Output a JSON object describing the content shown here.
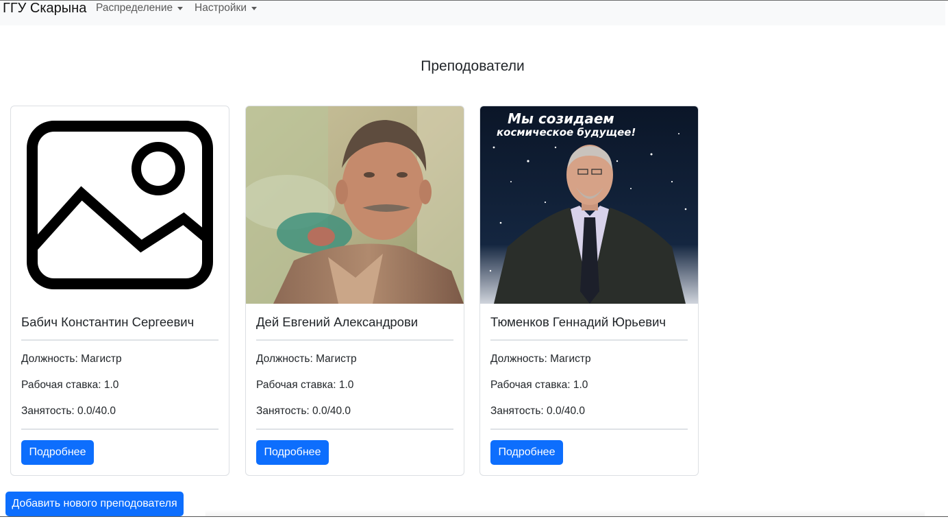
{
  "navbar": {
    "brand": "ГГУ Скарына",
    "items": [
      {
        "label": "Распределение"
      },
      {
        "label": "Настройки"
      }
    ]
  },
  "page": {
    "title": "Преподователи"
  },
  "teachers": [
    {
      "name": "Бабич Константин Сергеевич",
      "position": "Должность: Магистр",
      "rate": "Рабочая ставка: 1.0",
      "workload": "Занятость: 0.0/40.0",
      "details_label": "Подробнее",
      "photo": "placeholder-image-icon"
    },
    {
      "name": "Дей Евгений Александрови",
      "position": "Должность: Магистр",
      "rate": "Рабочая ставка: 1.0",
      "workload": "Занятость: 0.0/40.0",
      "details_label": "Подробнее",
      "photo": "teacher-photo"
    },
    {
      "name": "Тюменков Геннадий Юрьевич",
      "position": "Должность: Магистр",
      "rate": "Рабочая ставка: 1.0",
      "workload": "Занятость: 0.0/40.0",
      "details_label": "Подробнее",
      "photo": "teacher-photo",
      "photo_caption_line1": "Мы созидаем",
      "photo_caption_line2": "космическое будущее!"
    }
  ],
  "actions": {
    "add_teacher_label": "Добавить нового преподователя"
  },
  "colors": {
    "primary": "#0d6efd",
    "navbar_bg": "#f8f9fa",
    "card_border": "#dcdfe3"
  }
}
